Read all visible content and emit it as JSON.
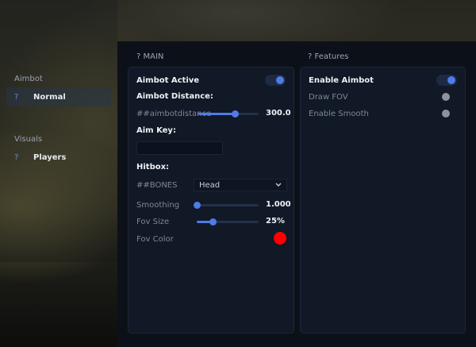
{
  "sidebar": {
    "groups": [
      {
        "title": "Aimbot",
        "items": [
          {
            "icon": "?",
            "label": "Normal",
            "active": true
          }
        ]
      },
      {
        "title": "Visuals",
        "items": [
          {
            "icon": "?",
            "label": "Players",
            "active": false
          }
        ]
      }
    ]
  },
  "main_panel": {
    "title": "? MAIN",
    "aimbot_active": {
      "label": "Aimbot Active",
      "on": true
    },
    "aimbot_distance": {
      "label": "Aimbot Distance:",
      "slider_label": "##aimbotdistance",
      "value": "300.0",
      "fraction": 0.6
    },
    "aim_key": {
      "label": "Aim Key:",
      "value": ""
    },
    "hitbox": {
      "label": "Hitbox:",
      "select_label": "##BONES",
      "selected": "Head"
    },
    "smoothing": {
      "label": "Smoothing",
      "value": "1.000",
      "fraction": 0.0
    },
    "fov_size": {
      "label": "Fov Size",
      "value": "25%",
      "fraction": 0.25
    },
    "fov_color": {
      "label": "Fov Color",
      "color": "#ff0000"
    }
  },
  "features_panel": {
    "title": "? Features",
    "enable_aimbot": {
      "label": "Enable Aimbot",
      "on": true
    },
    "draw_fov": {
      "label": "Draw FOV",
      "on": false
    },
    "enable_smooth": {
      "label": "Enable Smooth",
      "on": false
    }
  },
  "colors": {
    "accent": "#4e7be6",
    "panel": "#111826",
    "fov_color": "#ff0000"
  }
}
